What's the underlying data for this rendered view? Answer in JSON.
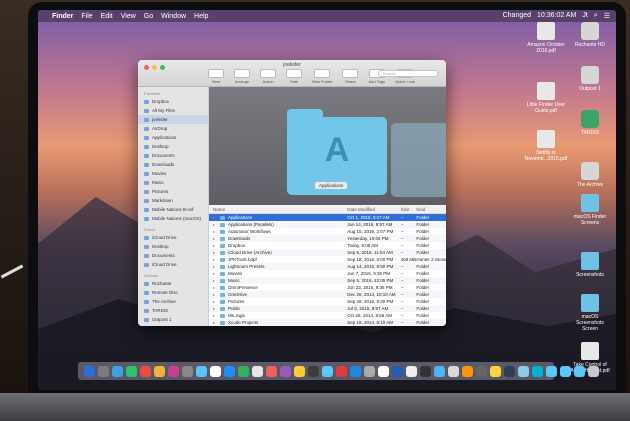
{
  "menubar": {
    "app": "Finder",
    "items": [
      "File",
      "Edit",
      "View",
      "Go",
      "Window",
      "Help"
    ],
    "status_changed": "Changed",
    "clock": "10:36:02 AM",
    "user": "Jt"
  },
  "window": {
    "title": "joeksfer",
    "toolbar": [
      "View",
      "Arrange",
      "Action",
      "Path",
      "New Folder",
      "Share",
      "Add Tags",
      "Quick Look"
    ],
    "search_placeholder": "Search"
  },
  "sidebar": {
    "sections": [
      {
        "heading": "Favorites",
        "items": [
          "Dropbox",
          "All My Files",
          "joeksfer",
          "AirDrop",
          "Applications",
          "Desktop",
          "Documents",
          "Downloads",
          "Movies",
          "Music",
          "Pictures",
          "Markdown",
          "Mobile Nations B-roll",
          "Mobile Nations (macOS)"
        ]
      },
      {
        "heading": "iCloud",
        "items": [
          "iCloud Drive",
          "Desktop",
          "Documents",
          "iCloud Drive"
        ]
      },
      {
        "heading": "Devices",
        "items": [
          "Rochante",
          "Remote Disc",
          "The Archive",
          "TARDIS",
          "Outpost 1"
        ]
      },
      {
        "heading": "Shared",
        "items": [
          "Joe's Time Capsule"
        ]
      }
    ]
  },
  "preview": {
    "caption": "Applications"
  },
  "list": {
    "headers": {
      "name": "Name",
      "date": "Date Modified",
      "size": "Size",
      "kind": "Kind"
    },
    "rows": [
      {
        "name": "Applications",
        "date": "Oct 1, 2016, 8:17 AM",
        "size": "--",
        "kind": "Folder"
      },
      {
        "name": "Applications (Parallels)",
        "date": "Jun 14, 2016, 8:57 AM",
        "size": "--",
        "kind": "Folder"
      },
      {
        "name": "Automator Workflows",
        "date": "Aug 15, 2016, 2:07 PM",
        "size": "--",
        "kind": "Folder"
      },
      {
        "name": "Downloads",
        "date": "Yesterday, 10:06 PM",
        "size": "--",
        "kind": "Folder"
      },
      {
        "name": "Dropbox",
        "date": "Today, 9:08 AM",
        "size": "--",
        "kind": "Folder"
      },
      {
        "name": "iCloud Drive (Archive)",
        "date": "Sep 6, 2016, 11:54 AM",
        "size": "--",
        "kind": "Folder"
      },
      {
        "name": "JPKTools.hdpf",
        "date": "Sep 18, 2016, 8:00 PM",
        "size": "408 MB",
        "kind": "Hunter 2 Storage"
      },
      {
        "name": "Lightroom Presets",
        "date": "Aug 14, 2016, 8:50 PM",
        "size": "--",
        "kind": "Folder"
      },
      {
        "name": "Movies",
        "date": "Jun 7, 2016, 9:36 PM",
        "size": "--",
        "kind": "Folder"
      },
      {
        "name": "Music",
        "date": "Sep 6, 2016, 12:05 PM",
        "size": "--",
        "kind": "Folder"
      },
      {
        "name": "OmniPresence",
        "date": "Jun 23, 2016, 9:36 PM",
        "size": "--",
        "kind": "Folder"
      },
      {
        "name": "OneDrive",
        "date": "Dec 28, 2014, 10:10 AM",
        "size": "--",
        "kind": "Folder"
      },
      {
        "name": "Pictures",
        "date": "Sep 28, 2016, 9:40 PM",
        "size": "--",
        "kind": "Folder"
      },
      {
        "name": "Public",
        "date": "Jul 8, 2016, 8:57 AM",
        "size": "--",
        "kind": "Folder"
      },
      {
        "name": "Ms.Jugs",
        "date": "Oct 26, 2014, 8:55 AM",
        "size": "--",
        "kind": "Folder"
      },
      {
        "name": "Xcode Projects",
        "date": "Sep 18, 2014, 9:10 AM",
        "size": "--",
        "kind": "Folder"
      }
    ]
  },
  "desktop_icons": [
    {
      "label": "Amazon October 2016.pdf",
      "type": "doc"
    },
    {
      "label": "Rochante HD",
      "type": "drive"
    },
    {
      "label": "Little Finder User Guide.pdf",
      "type": "doc"
    },
    {
      "label": "Outpost 1",
      "type": "drive"
    },
    {
      "label": "Netflix in Novemb...2016.pdf",
      "type": "doc"
    },
    {
      "label": "TARDIS",
      "type": "tm"
    },
    {
      "label": "The Archive",
      "type": "drive"
    },
    {
      "label": "macOS Finder Screens",
      "type": "folder"
    },
    {
      "label": "Screenshots",
      "type": "folder"
    },
    {
      "label": "macOS Screenshots Screen",
      "type": "folder"
    },
    {
      "label": "Take Control of Audio Hi...last.pdf",
      "type": "doc"
    }
  ],
  "colors": {
    "accent": "#2f6fd6",
    "folder": "#74c6e8",
    "close": "#fc615d",
    "minimize": "#fdbc40",
    "zoom": "#34c84a"
  }
}
